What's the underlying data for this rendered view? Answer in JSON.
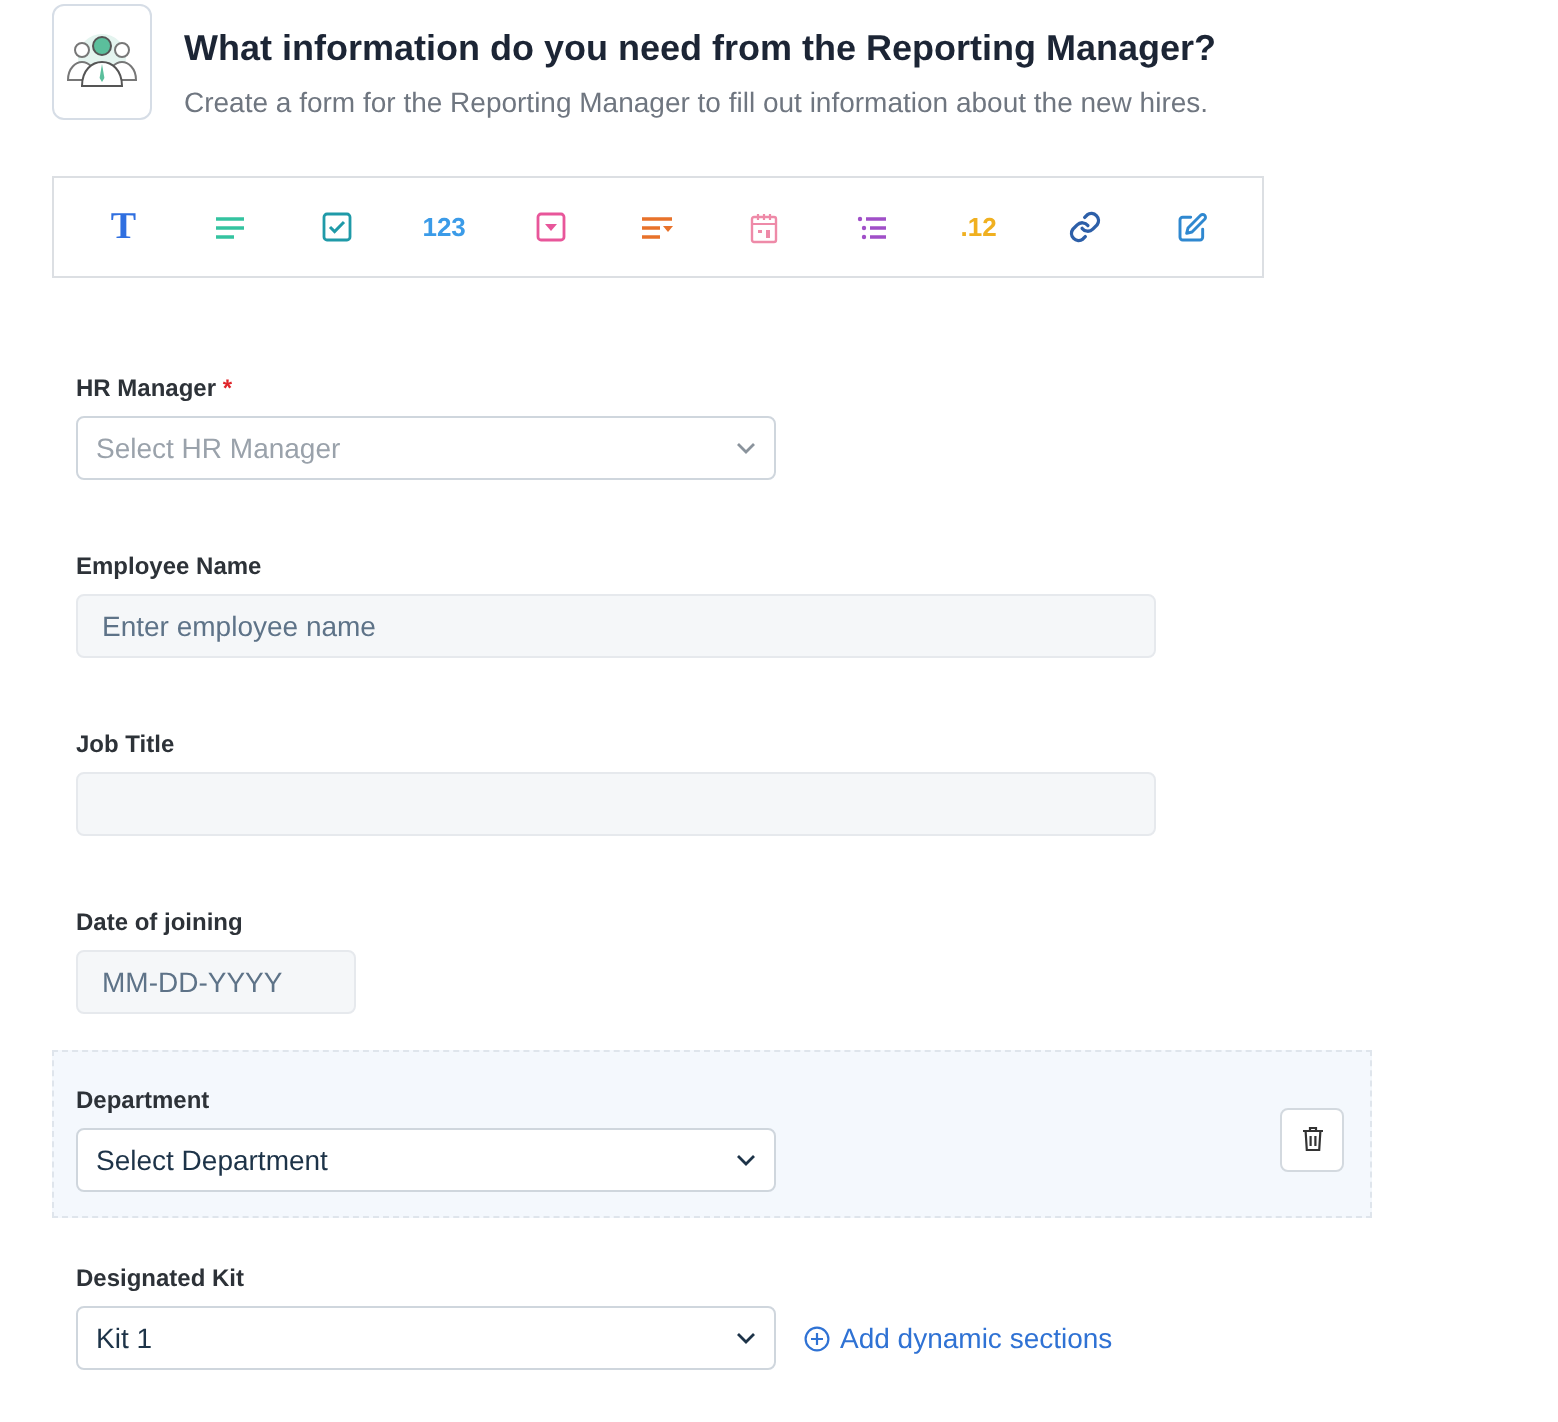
{
  "header": {
    "title": "What information do you need from the Reporting Manager?",
    "subtitle": "Create a form for the Reporting Manager to fill out information about the new hires."
  },
  "toolbar": [
    {
      "kind": "text",
      "label": "T",
      "color": "#2f6fe0"
    },
    {
      "kind": "icon",
      "color": "#34c3a0"
    },
    {
      "kind": "icon",
      "color": "#1f9aa8"
    },
    {
      "kind": "text",
      "label": "123",
      "color": "#3b9be8"
    },
    {
      "kind": "icon",
      "color": "#e8569a"
    },
    {
      "kind": "icon",
      "color": "#e8722a"
    },
    {
      "kind": "icon",
      "color": "#ee8aa8"
    },
    {
      "kind": "icon",
      "color": "#a04fc8"
    },
    {
      "kind": "text",
      "label": ".12",
      "color": "#f0b020"
    },
    {
      "kind": "icon",
      "color": "#2d5fa8"
    },
    {
      "kind": "icon",
      "color": "#2f88d0"
    }
  ],
  "fields": [
    {
      "kind": "select",
      "label": "HR Manager",
      "required_mark": "*",
      "placeholder": "Select HR Manager",
      "highlighted": false
    },
    {
      "kind": "text",
      "label": "Employee Name",
      "placeholder": "Enter employee name",
      "highlighted": false
    },
    {
      "kind": "text",
      "label": "Job Title",
      "highlighted": false
    },
    {
      "kind": "date",
      "label": "Date of joining",
      "placeholder": "MM-DD-YYYY",
      "highlighted": false
    },
    {
      "kind": "select",
      "label": "Department",
      "value": "Select Department",
      "highlighted": true
    },
    {
      "kind": "select",
      "label": "Designated Kit",
      "value": "Kit 1",
      "highlighted": false,
      "action": "Add dynamic sections"
    }
  ]
}
